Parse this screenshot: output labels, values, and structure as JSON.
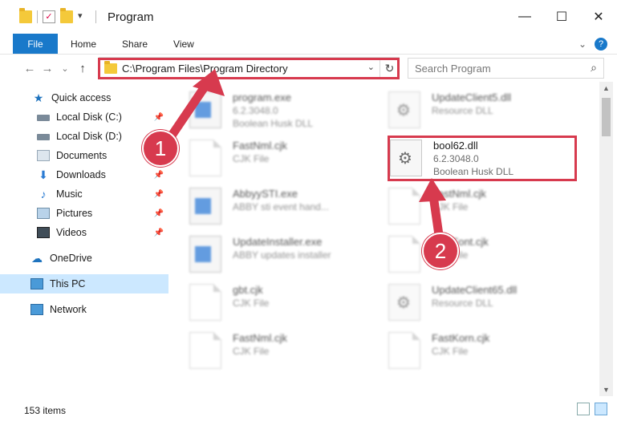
{
  "window": {
    "title": "Program",
    "minimize": "—",
    "maximize": "☐",
    "close": "✕"
  },
  "ribbon": {
    "tabs": [
      "File",
      "Home",
      "Share",
      "View"
    ],
    "expand": "⌄",
    "help": "?"
  },
  "address": {
    "back": "←",
    "forward": "→",
    "recent": "⌄",
    "up": "↑",
    "path": "C:\\Program Files\\Program Directory",
    "dropdown": "⌄",
    "refresh": "↻"
  },
  "search": {
    "placeholder": "Search Program",
    "icon": "⌕"
  },
  "sidebar": {
    "items": [
      {
        "label": "Quick access",
        "icon": "star-icon",
        "pinned": false
      },
      {
        "label": "Local Disk (C:)",
        "icon": "disk-icon",
        "pinned": true
      },
      {
        "label": "Local Disk (D:)",
        "icon": "disk-icon",
        "pinned": false
      },
      {
        "label": "Documents",
        "icon": "documents-icon",
        "pinned": true
      },
      {
        "label": "Downloads",
        "icon": "download-icon",
        "pinned": true
      },
      {
        "label": "Music",
        "icon": "music-icon",
        "pinned": true
      },
      {
        "label": "Pictures",
        "icon": "pictures-icon",
        "pinned": true
      },
      {
        "label": "Videos",
        "icon": "videos-icon",
        "pinned": true
      },
      {
        "label": "OneDrive",
        "icon": "cloud-icon",
        "pinned": false
      },
      {
        "label": "This PC",
        "icon": "pc-icon",
        "pinned": false,
        "selected": true
      },
      {
        "label": "Network",
        "icon": "network-icon",
        "pinned": false
      }
    ],
    "pin_glyph": "📌"
  },
  "files": [
    {
      "name": "program.exe",
      "line2": "6.2.3048.0",
      "line3": "Boolean Husk DLL",
      "icon": "app-icon",
      "blurred": true
    },
    {
      "name": "UpdateClient5.dll",
      "line2": "Resource DLL",
      "line3": "",
      "icon": "gear-file-icon",
      "blurred": true
    },
    {
      "name": "FastNml.cjk",
      "line2": "CJK File",
      "line3": "",
      "icon": "document-icon",
      "blurred": true
    },
    {
      "name": "bool62.dll",
      "line2": "6.2.3048.0",
      "line3": "Boolean Husk DLL",
      "icon": "gear-file-icon",
      "blurred": false
    },
    {
      "name": "AbbyySTI.exe",
      "line2": "ABBY sti event hand...",
      "line3": "",
      "icon": "app-icon",
      "blurred": true
    },
    {
      "name": "FastNml.cjk",
      "line2": "CJK File",
      "line3": "",
      "icon": "document-icon",
      "blurred": true
    },
    {
      "name": "UpdateInstaller.exe",
      "line2": "ABBY updates installer",
      "line3": "",
      "icon": "app-icon",
      "blurred": true
    },
    {
      "name": "FastFont.cjk",
      "line2": "CJK File",
      "line3": "",
      "icon": "document-icon",
      "blurred": true
    },
    {
      "name": "gbt.cjk",
      "line2": "CJK File",
      "line3": "",
      "icon": "document-icon",
      "blurred": true
    },
    {
      "name": "UpdateClient65.dll",
      "line2": "Resource DLL",
      "line3": "",
      "icon": "gear-file-icon",
      "blurred": true
    },
    {
      "name": "FastNml.cjk",
      "line2": "CJK File",
      "line3": "",
      "icon": "document-icon",
      "blurred": true
    },
    {
      "name": "FastKorn.cjk",
      "line2": "CJK File",
      "line3": "",
      "icon": "document-icon",
      "blurred": true
    }
  ],
  "status": {
    "item_count": "153 items"
  },
  "callouts": [
    "1",
    "2"
  ],
  "colors": {
    "accent": "#1979ca",
    "highlight": "#d73a4e",
    "selected": "#cce8ff"
  }
}
